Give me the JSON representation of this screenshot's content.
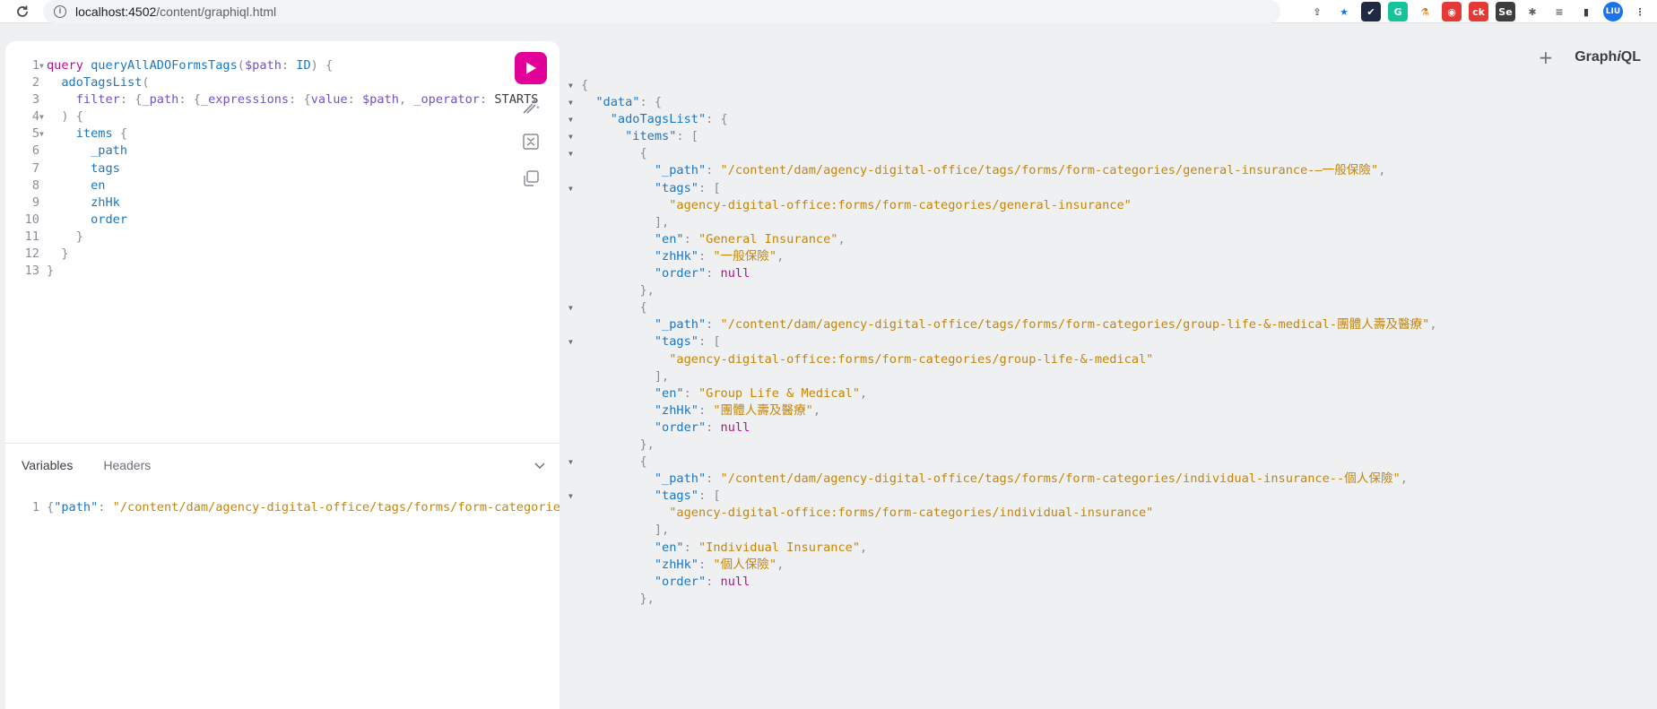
{
  "browser": {
    "url_host": "localhost:4502",
    "url_path": "/content/graphiql.html",
    "extensions": [
      {
        "name": "share-icon",
        "label": "⇪",
        "color": "#ffffff",
        "fg": "#5f6368"
      },
      {
        "name": "bookmark-star-icon",
        "label": "★",
        "color": "#ffffff",
        "fg": "#1a73e8"
      },
      {
        "name": "ext-check-icon",
        "label": "✔",
        "color": "#1e2a44",
        "fg": "#ffffff"
      },
      {
        "name": "ext-grammarly-icon",
        "label": "G",
        "color": "#15c39a",
        "fg": "#ffffff"
      },
      {
        "name": "ext-flask-icon",
        "label": "⚗",
        "color": "#ffffff",
        "fg": "#e8710a"
      },
      {
        "name": "ext-red-icon",
        "label": "◉",
        "color": "#e53935",
        "fg": "#ffffff"
      },
      {
        "name": "ext-ck-icon",
        "label": "ck",
        "color": "#e53935",
        "fg": "#ffffff"
      },
      {
        "name": "ext-se-icon",
        "label": "Se",
        "color": "#3d3d3d",
        "fg": "#ffffff"
      },
      {
        "name": "extensions-puzzle-icon",
        "label": "✱",
        "color": "#ffffff",
        "fg": "#5f6368"
      },
      {
        "name": "media-icon",
        "label": "≡",
        "color": "#ffffff",
        "fg": "#5f6368"
      },
      {
        "name": "sidepanel-icon",
        "label": "▮",
        "color": "#ffffff",
        "fg": "#3b3d45"
      },
      {
        "name": "profile-avatar-icon",
        "label": "LIU",
        "color": "#1a73e8",
        "fg": "#ffffff"
      },
      {
        "name": "more-menu-icon",
        "label": "⋮",
        "color": "#ffffff",
        "fg": "#5f6368"
      }
    ]
  },
  "editor": {
    "lines": [
      {
        "n": "1",
        "fold": "▼",
        "tokens": [
          [
            "kw",
            "query"
          ],
          [
            "",
            " "
          ],
          [
            "def",
            "queryAllADOFormsTags"
          ],
          [
            "pun",
            "("
          ],
          [
            "var",
            "$path"
          ],
          [
            "pun",
            ":"
          ],
          [
            "",
            " "
          ],
          [
            "def",
            "ID"
          ],
          [
            "pun",
            ")"
          ],
          [
            "",
            " "
          ],
          [
            "pun",
            "{"
          ]
        ]
      },
      {
        "n": "2",
        "fold": "",
        "tokens": [
          [
            "",
            "  "
          ],
          [
            "fld",
            "adoTagsList"
          ],
          [
            "pun",
            "("
          ]
        ]
      },
      {
        "n": "3",
        "fold": "",
        "tokens": [
          [
            "",
            "    "
          ],
          [
            "var",
            "filter"
          ],
          [
            "pun",
            ": {"
          ],
          [
            "var",
            "_path"
          ],
          [
            "pun",
            ": {"
          ],
          [
            "var",
            "_expressions"
          ],
          [
            "pun",
            ": {"
          ],
          [
            "var",
            "value"
          ],
          [
            "pun",
            ":"
          ],
          [
            "",
            " "
          ],
          [
            "var",
            "$path"
          ],
          [
            "pun",
            ","
          ],
          [
            "",
            " "
          ],
          [
            "var",
            "_operator"
          ],
          [
            "pun",
            ":"
          ],
          [
            "",
            " "
          ],
          [
            "",
            "STARTS"
          ]
        ]
      },
      {
        "n": "4",
        "fold": "▼",
        "tokens": [
          [
            "",
            "  "
          ],
          [
            "pun",
            ") {"
          ]
        ]
      },
      {
        "n": "5",
        "fold": "▼",
        "tokens": [
          [
            "",
            "    "
          ],
          [
            "fld",
            "items"
          ],
          [
            "",
            " "
          ],
          [
            "pun",
            "{"
          ]
        ]
      },
      {
        "n": "6",
        "fold": "",
        "tokens": [
          [
            "",
            "      "
          ],
          [
            "fld",
            "_path"
          ]
        ]
      },
      {
        "n": "7",
        "fold": "",
        "tokens": [
          [
            "",
            "      "
          ],
          [
            "fld",
            "tags"
          ]
        ]
      },
      {
        "n": "8",
        "fold": "",
        "tokens": [
          [
            "",
            "      "
          ],
          [
            "fld",
            "en"
          ]
        ]
      },
      {
        "n": "9",
        "fold": "",
        "tokens": [
          [
            "",
            "      "
          ],
          [
            "fld",
            "zhHk"
          ]
        ]
      },
      {
        "n": "10",
        "fold": "",
        "tokens": [
          [
            "",
            "      "
          ],
          [
            "fld",
            "order"
          ]
        ]
      },
      {
        "n": "11",
        "fold": "",
        "tokens": [
          [
            "",
            "    "
          ],
          [
            "pun",
            "}"
          ]
        ]
      },
      {
        "n": "12",
        "fold": "",
        "tokens": [
          [
            "",
            "  "
          ],
          [
            "pun",
            "}"
          ]
        ]
      },
      {
        "n": "13",
        "fold": "",
        "tokens": [
          [
            "pun",
            "}"
          ]
        ]
      }
    ],
    "variables_tab": "Variables",
    "headers_tab": "Headers",
    "variables_line": {
      "n": "1",
      "tokens": [
        [
          "pun",
          "{"
        ],
        [
          "prp",
          "\"path\""
        ],
        [
          "pun",
          ":"
        ],
        [
          "",
          " "
        ],
        [
          "str",
          "\"/content/dam/agency-digital-office/tags/forms/form-categories\""
        ],
        [
          "pun",
          "}"
        ]
      ]
    }
  },
  "response": {
    "brand_prefix": "Graph",
    "brand_italic": "i",
    "brand_suffix": "QL",
    "plus_label": "+",
    "lines": [
      {
        "fold": "▼",
        "tokens": [
          [
            "pun",
            "{"
          ]
        ]
      },
      {
        "fold": "▼",
        "tokens": [
          [
            "",
            "  "
          ],
          [
            "prp",
            "\"data\""
          ],
          [
            "pun",
            ": {"
          ]
        ]
      },
      {
        "fold": "▼",
        "tokens": [
          [
            "",
            "    "
          ],
          [
            "prp",
            "\"adoTagsList\""
          ],
          [
            "pun",
            ": {"
          ]
        ]
      },
      {
        "fold": "▼",
        "tokens": [
          [
            "",
            "      "
          ],
          [
            "prp",
            "\"items\""
          ],
          [
            "pun",
            ": ["
          ]
        ]
      },
      {
        "fold": "▼",
        "tokens": [
          [
            "",
            "        "
          ],
          [
            "pun",
            "{"
          ]
        ]
      },
      {
        "fold": "",
        "tokens": [
          [
            "",
            "          "
          ],
          [
            "prp",
            "\"_path\""
          ],
          [
            "pun",
            ":"
          ],
          [
            "",
            " "
          ],
          [
            "str",
            "\"/content/dam/agency-digital-office/tags/forms/form-categories/general-insurance-—一般保險\""
          ],
          [
            "pun",
            ","
          ]
        ]
      },
      {
        "fold": "▼",
        "tokens": [
          [
            "",
            "          "
          ],
          [
            "prp",
            "\"tags\""
          ],
          [
            "pun",
            ": ["
          ]
        ]
      },
      {
        "fold": "",
        "tokens": [
          [
            "",
            "            "
          ],
          [
            "str",
            "\"agency-digital-office:forms/form-categories/general-insurance\""
          ]
        ]
      },
      {
        "fold": "",
        "tokens": [
          [
            "",
            "          "
          ],
          [
            "pun",
            "],"
          ]
        ]
      },
      {
        "fold": "",
        "tokens": [
          [
            "",
            "          "
          ],
          [
            "prp",
            "\"en\""
          ],
          [
            "pun",
            ":"
          ],
          [
            "",
            " "
          ],
          [
            "str",
            "\"General Insurance\""
          ],
          [
            "pun",
            ","
          ]
        ]
      },
      {
        "fold": "",
        "tokens": [
          [
            "",
            "          "
          ],
          [
            "prp",
            "\"zhHk\""
          ],
          [
            "pun",
            ":"
          ],
          [
            "",
            " "
          ],
          [
            "str",
            "\"一般保險\""
          ],
          [
            "pun",
            ","
          ]
        ]
      },
      {
        "fold": "",
        "tokens": [
          [
            "",
            "          "
          ],
          [
            "prp",
            "\"order\""
          ],
          [
            "pun",
            ":"
          ],
          [
            "",
            " "
          ],
          [
            "nul",
            "null"
          ]
        ]
      },
      {
        "fold": "",
        "tokens": [
          [
            "",
            "        "
          ],
          [
            "pun",
            "},"
          ]
        ]
      },
      {
        "fold": "▼",
        "tokens": [
          [
            "",
            "        "
          ],
          [
            "pun",
            "{"
          ]
        ]
      },
      {
        "fold": "",
        "tokens": [
          [
            "",
            "          "
          ],
          [
            "prp",
            "\"_path\""
          ],
          [
            "pun",
            ":"
          ],
          [
            "",
            " "
          ],
          [
            "str",
            "\"/content/dam/agency-digital-office/tags/forms/form-categories/group-life-&-medical-團體人壽及醫療\""
          ],
          [
            "pun",
            ","
          ]
        ]
      },
      {
        "fold": "▼",
        "tokens": [
          [
            "",
            "          "
          ],
          [
            "prp",
            "\"tags\""
          ],
          [
            "pun",
            ": ["
          ]
        ]
      },
      {
        "fold": "",
        "tokens": [
          [
            "",
            "            "
          ],
          [
            "str",
            "\"agency-digital-office:forms/form-categories/group-life-&-medical\""
          ]
        ]
      },
      {
        "fold": "",
        "tokens": [
          [
            "",
            "          "
          ],
          [
            "pun",
            "],"
          ]
        ]
      },
      {
        "fold": "",
        "tokens": [
          [
            "",
            "          "
          ],
          [
            "prp",
            "\"en\""
          ],
          [
            "pun",
            ":"
          ],
          [
            "",
            " "
          ],
          [
            "str",
            "\"Group Life & Medical\""
          ],
          [
            "pun",
            ","
          ]
        ]
      },
      {
        "fold": "",
        "tokens": [
          [
            "",
            "          "
          ],
          [
            "prp",
            "\"zhHk\""
          ],
          [
            "pun",
            ":"
          ],
          [
            "",
            " "
          ],
          [
            "str",
            "\"團體人壽及醫療\""
          ],
          [
            "pun",
            ","
          ]
        ]
      },
      {
        "fold": "",
        "tokens": [
          [
            "",
            "          "
          ],
          [
            "prp",
            "\"order\""
          ],
          [
            "pun",
            ":"
          ],
          [
            "",
            " "
          ],
          [
            "nul",
            "null"
          ]
        ]
      },
      {
        "fold": "",
        "tokens": [
          [
            "",
            "        "
          ],
          [
            "pun",
            "},"
          ]
        ]
      },
      {
        "fold": "▼",
        "tokens": [
          [
            "",
            "        "
          ],
          [
            "pun",
            "{"
          ]
        ]
      },
      {
        "fold": "",
        "tokens": [
          [
            "",
            "          "
          ],
          [
            "prp",
            "\"_path\""
          ],
          [
            "pun",
            ":"
          ],
          [
            "",
            " "
          ],
          [
            "str",
            "\"/content/dam/agency-digital-office/tags/forms/form-categories/individual-insurance--個人保險\""
          ],
          [
            "pun",
            ","
          ]
        ]
      },
      {
        "fold": "▼",
        "tokens": [
          [
            "",
            "          "
          ],
          [
            "prp",
            "\"tags\""
          ],
          [
            "pun",
            ": ["
          ]
        ]
      },
      {
        "fold": "",
        "tokens": [
          [
            "",
            "            "
          ],
          [
            "str",
            "\"agency-digital-office:forms/form-categories/individual-insurance\""
          ]
        ]
      },
      {
        "fold": "",
        "tokens": [
          [
            "",
            "          "
          ],
          [
            "pun",
            "],"
          ]
        ]
      },
      {
        "fold": "",
        "tokens": [
          [
            "",
            "          "
          ],
          [
            "prp",
            "\"en\""
          ],
          [
            "pun",
            ":"
          ],
          [
            "",
            " "
          ],
          [
            "str",
            "\"Individual Insurance\""
          ],
          [
            "pun",
            ","
          ]
        ]
      },
      {
        "fold": "",
        "tokens": [
          [
            "",
            "          "
          ],
          [
            "prp",
            "\"zhHk\""
          ],
          [
            "pun",
            ":"
          ],
          [
            "",
            " "
          ],
          [
            "str",
            "\"個人保險\""
          ],
          [
            "pun",
            ","
          ]
        ]
      },
      {
        "fold": "",
        "tokens": [
          [
            "",
            "          "
          ],
          [
            "prp",
            "\"order\""
          ],
          [
            "pun",
            ":"
          ],
          [
            "",
            " "
          ],
          [
            "nul",
            "null"
          ]
        ]
      },
      {
        "fold": "",
        "tokens": [
          [
            "",
            "        "
          ],
          [
            "pun",
            "},"
          ]
        ]
      }
    ]
  },
  "colors": {
    "run_button": "#e10098",
    "keyword": "#b0128c",
    "string": "#c4860a",
    "property": "#1c76c2",
    "variable": "#7352c5"
  }
}
